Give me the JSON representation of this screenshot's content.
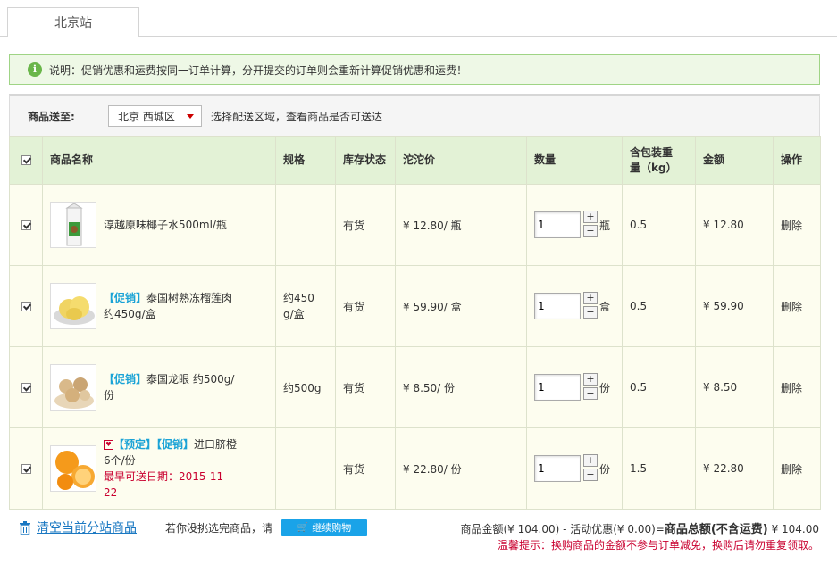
{
  "tab": {
    "label": "北京站"
  },
  "notice": {
    "icon": "info-icon",
    "text": "说明：促销优惠和运费按同一订单计算，分开提交的订单则会重新计算促销优惠和运费！"
  },
  "shipping": {
    "label": "商品送至:",
    "region": "北京 西城区",
    "hint": "选择配送区域，查看商品是否可送达"
  },
  "table": {
    "headers": {
      "name": "商品名称",
      "spec": "规格",
      "stock": "库存状态",
      "price": "沱沱价",
      "qty": "数量",
      "weight_line1": "含包装重",
      "weight_line2": "量（kg）",
      "amount": "金额",
      "ops": "操作"
    },
    "rows": [
      {
        "title": "淳越原味椰子水500ml/瓶",
        "spec": "",
        "stock": "有货",
        "price": "¥ 12.80/ 瓶",
        "qty": "1",
        "unit": "瓶",
        "weight": "0.5",
        "amount": "¥ 12.80",
        "op": "删除"
      },
      {
        "tag": "【促销】",
        "title": "泰国树熟冻榴莲肉约450g/盒",
        "spec": "约450g/盒",
        "stock": "有货",
        "price": "¥ 59.90/ 盒",
        "qty": "1",
        "unit": "盒",
        "weight": "0.5",
        "amount": "¥ 59.90",
        "op": "删除"
      },
      {
        "tag": "【促销】",
        "title": "泰国龙眼 约500g/份",
        "spec": "约500g",
        "stock": "有货",
        "price": "¥ 8.50/ 份",
        "qty": "1",
        "unit": "份",
        "weight": "0.5",
        "amount": "¥ 8.50",
        "op": "删除"
      },
      {
        "tag1": "【预定】",
        "tag2": "【促销】",
        "title": "进口脐橙 6个/份",
        "ship_date": "最早可送日期：2015-11-22",
        "spec": "",
        "stock": "有货",
        "price": "¥ 22.80/ 份",
        "qty": "1",
        "unit": "份",
        "weight": "1.5",
        "amount": "¥ 22.80",
        "op": "删除"
      }
    ]
  },
  "footer": {
    "clear": "清空当前分站商品",
    "not_chosen": "若你没挑选完商品，请",
    "continue": "继续购物",
    "totals_text": "商品金额(¥ 104.00) - 活动优惠(¥ 0.00)=",
    "totals_label": "商品总额(不含运费)",
    "totals_value": "¥ 104.00",
    "tip": "温馨提示：换购商品的金额不参与订单减免，换购后请勿重复领取。"
  },
  "colors": {
    "accent_green": "#e3f2d6",
    "link_blue": "#1a78c2",
    "promo_blue": "#1aa3d6",
    "warn_red": "#c9002f"
  }
}
